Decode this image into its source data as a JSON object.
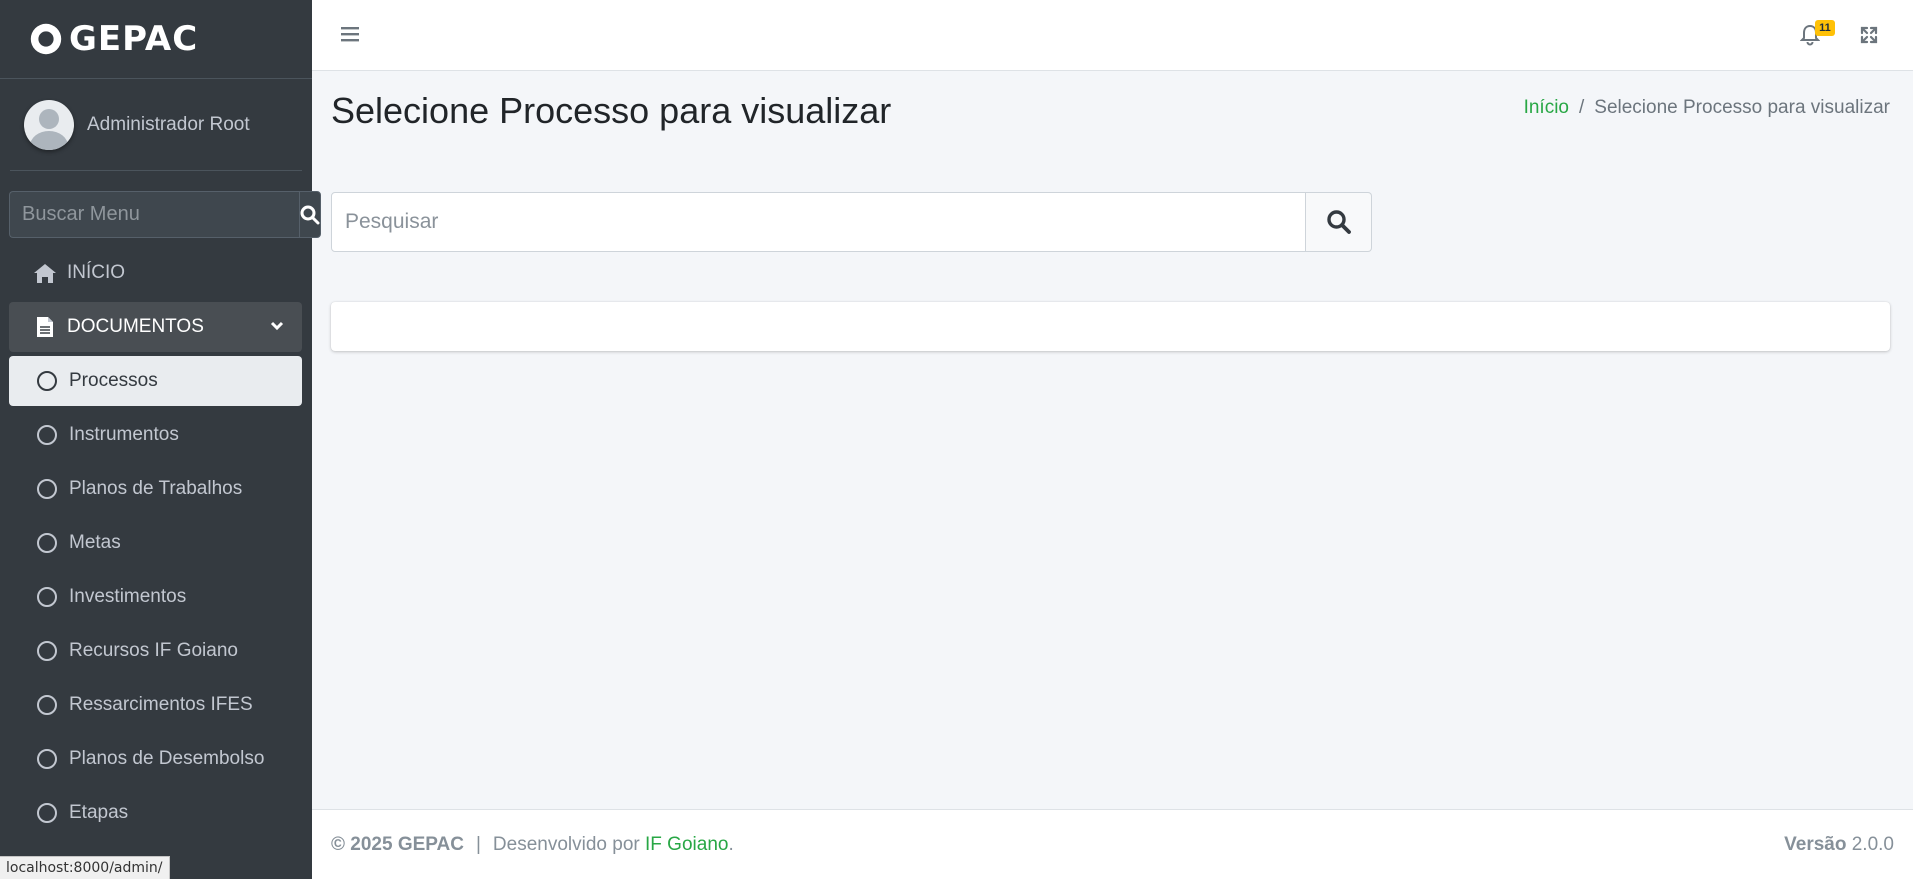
{
  "brand": {
    "name": "GEPAC"
  },
  "user": {
    "name": "Administrador Root"
  },
  "sidebar": {
    "search_placeholder": "Buscar Menu",
    "home_label": "INÍCIO",
    "documents_label": "DOCUMENTOS",
    "sub_items": [
      {
        "label": "Processos"
      },
      {
        "label": "Instrumentos"
      },
      {
        "label": "Planos de Trabalhos"
      },
      {
        "label": "Metas"
      },
      {
        "label": "Investimentos"
      },
      {
        "label": "Recursos IF Goiano"
      },
      {
        "label": "Ressarcimentos IFES"
      },
      {
        "label": "Planos de Desembolso"
      },
      {
        "label": "Etapas"
      }
    ]
  },
  "header": {
    "notification_count": "11"
  },
  "main": {
    "title": "Selecione Processo para visualizar",
    "breadcrumb": {
      "home": "Início",
      "separator": "/",
      "current": "Selecione Processo para visualizar"
    },
    "search_placeholder": "Pesquisar"
  },
  "footer": {
    "copyright": "© 2025 GEPAC",
    "separator": "|",
    "developed_by": "Desenvolvido por",
    "org": "IF Goiano",
    "period": ".",
    "version_label": "Versão",
    "version_value": "2.0.0"
  },
  "status_bar": {
    "url": "localhost:8000/admin/"
  },
  "colors": {
    "sidebar_bg": "#343a40",
    "accent_green": "#28a745",
    "badge_yellow": "#ffc107",
    "content_bg": "#f4f6f9"
  },
  "icons": [
    "brand-logo-icon",
    "search-icon",
    "home-icon",
    "document-icon",
    "chevron-down-icon",
    "circle-icon",
    "hamburger-icon",
    "bell-icon",
    "expand-icon"
  ]
}
